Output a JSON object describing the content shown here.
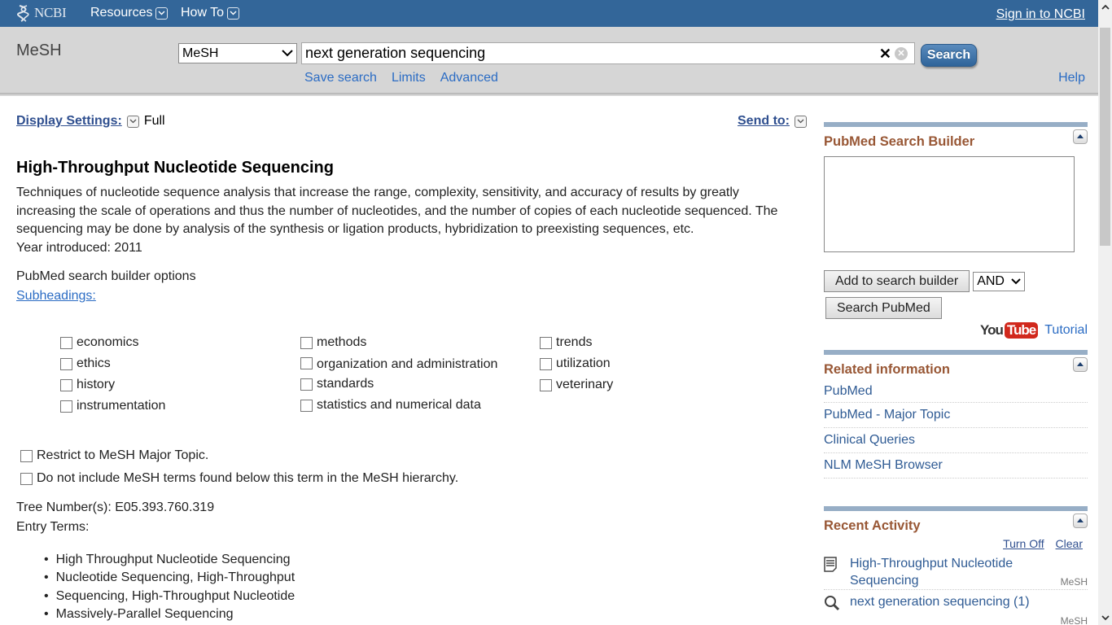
{
  "topbar": {
    "logo": "NCBI",
    "resources": "Resources",
    "howto": "How To",
    "signin": "Sign in to NCBI"
  },
  "search": {
    "db_title": "MeSH",
    "db_selected": "MeSH",
    "query": "next generation sequencing",
    "button": "Search",
    "links": [
      "Save search",
      "Limits",
      "Advanced"
    ],
    "help": "Help"
  },
  "display": {
    "settings_label": "Display Settings:",
    "settings_value": "Full",
    "send_to": "Send to:"
  },
  "record": {
    "heading": "High-Throughput Nucleotide Sequencing",
    "description": "Techniques of nucleotide sequence analysis that increase the range, complexity, sensitivity, and accuracy of results by greatly increasing the scale of operations and thus the number of nucleotides, and the number of copies of each nucleotide sequenced. The sequencing may be done by analysis of the synthesis or ligation products, hybridization to preexisting sequences, etc.",
    "year": "Year introduced: 2011",
    "builder_options": "PubMed search builder options",
    "subheadings_label": "Subheadings:",
    "subheadings": {
      "col1": [
        "economics",
        "ethics",
        "history",
        "instrumentation"
      ],
      "col2": [
        "methods",
        "organization and administration",
        "standards",
        "statistics and numerical data"
      ],
      "col3": [
        "trends",
        "utilization",
        "veterinary"
      ]
    },
    "options": [
      "Restrict to MeSH Major Topic.",
      "Do not include MeSH terms found below this term in the MeSH hierarchy."
    ],
    "tree_numbers": "Tree Number(s): E05.393.760.319",
    "entry_terms_label": "Entry Terms:",
    "entry_terms": [
      "High Throughput Nucleotide Sequencing",
      "Nucleotide Sequencing, High-Throughput",
      "Sequencing, High-Throughput Nucleotide",
      "Massively-Parallel Sequencing"
    ]
  },
  "sidebar": {
    "builder": {
      "title": "PubMed Search Builder",
      "box_value": "",
      "add_button": "Add to search builder",
      "operator": "AND",
      "search_button": "Search PubMed",
      "yt_you": "You",
      "yt_tube": "Tube",
      "tutorial": "Tutorial"
    },
    "related": {
      "title": "Related information",
      "items": [
        "PubMed",
        "PubMed - Major Topic",
        "Clinical Queries",
        "NLM MeSH Browser"
      ]
    },
    "recent": {
      "title": "Recent Activity",
      "turn_off": "Turn Off",
      "clear": "Clear",
      "items": [
        {
          "text": "High-Throughput Nucleotide Sequencing",
          "db": "MeSH",
          "icon": "document-icon"
        },
        {
          "text": "next generation sequencing (1)",
          "db": "MeSH",
          "icon": "search-icon"
        }
      ]
    }
  },
  "colors": {
    "topbar": "#336699",
    "link": "#2b6cc4",
    "portlet_title": "#985735",
    "portlet_bar": "#97aec6"
  }
}
